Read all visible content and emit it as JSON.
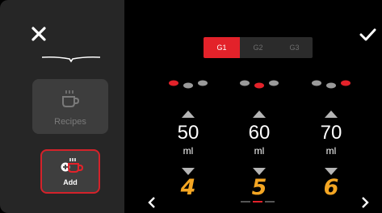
{
  "sidebar": {
    "close_icon": "close-icon",
    "brand_icon": "brand-line-icon",
    "tiles": [
      {
        "label": "Recipes",
        "icon": "coffee-cup-icon",
        "enabled": false
      },
      {
        "label": "Add",
        "icon": "add-coffee-cup-icon",
        "enabled": true
      }
    ]
  },
  "header": {
    "confirm_icon": "check-icon",
    "groups": [
      {
        "label": "G1",
        "active": true
      },
      {
        "label": "G2",
        "active": false
      },
      {
        "label": "G3",
        "active": false
      }
    ]
  },
  "columns": [
    {
      "value": "50",
      "unit": "ml",
      "number": "4",
      "active_dot": 0
    },
    {
      "value": "60",
      "unit": "ml",
      "number": "5",
      "active_dot": 1
    },
    {
      "value": "70",
      "unit": "ml",
      "number": "6",
      "active_dot": 2
    }
  ],
  "pager": {
    "pages": 3,
    "current": 1
  },
  "colors": {
    "accent": "#e3222a",
    "number_orange": "#f4a623",
    "sidebar_bg": "#262626",
    "inactive_dot": "#9a9a9a"
  }
}
